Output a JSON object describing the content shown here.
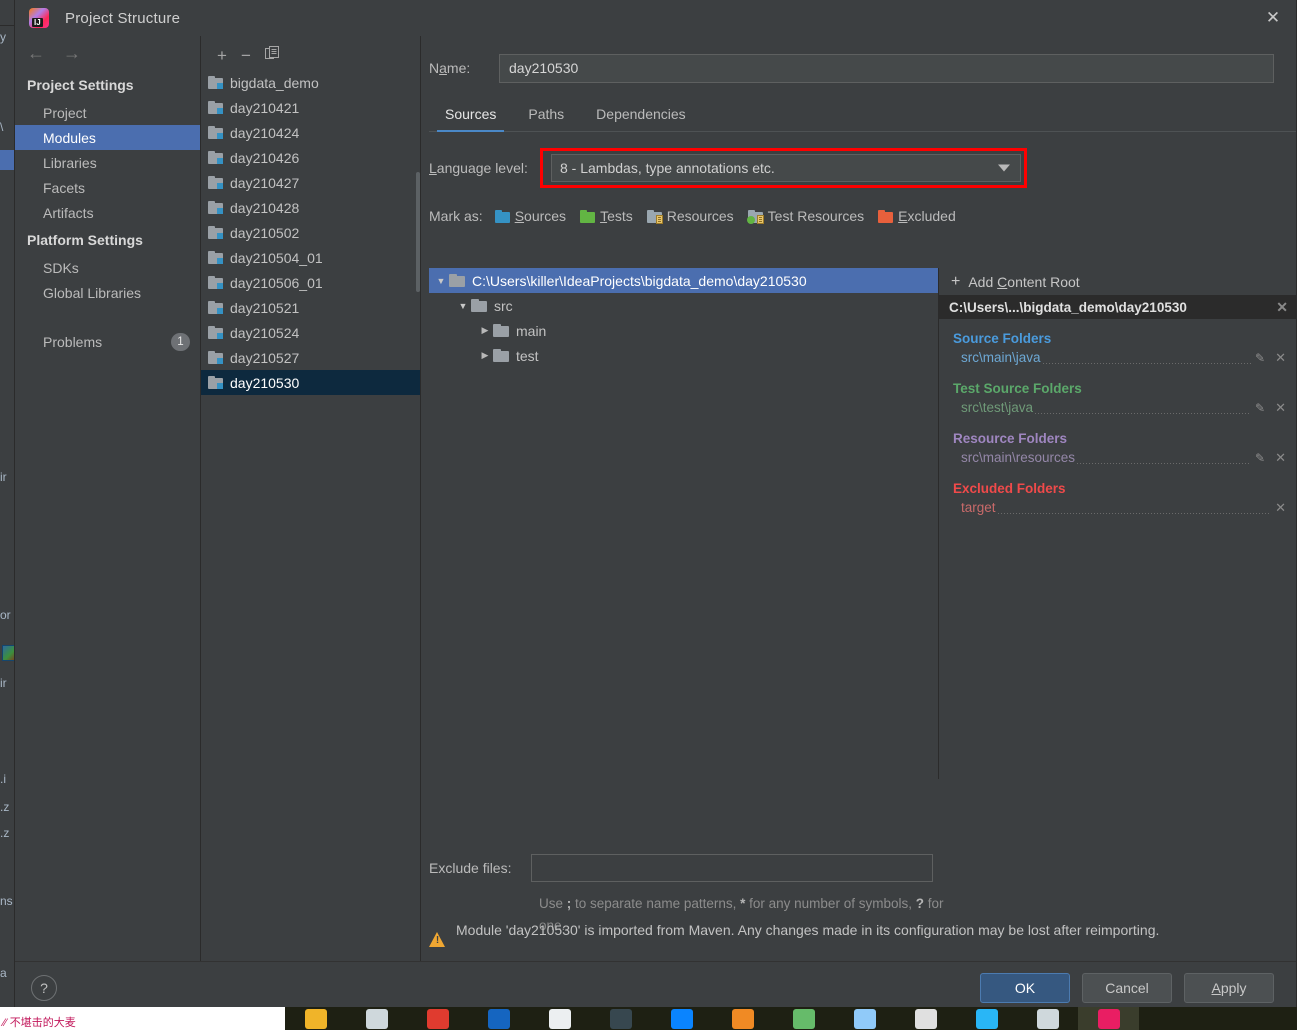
{
  "window": {
    "title": "Project Structure",
    "app_icon": "intellij-idea-icon",
    "close_icon": "✕"
  },
  "nav": {
    "back_icon": "←",
    "forward_icon": "→",
    "groups": [
      {
        "title": "Project Settings",
        "items": [
          {
            "label": "Project",
            "selected": false
          },
          {
            "label": "Modules",
            "selected": true
          },
          {
            "label": "Libraries",
            "selected": false
          },
          {
            "label": "Facets",
            "selected": false
          },
          {
            "label": "Artifacts",
            "selected": false
          }
        ]
      },
      {
        "title": "Platform Settings",
        "items": [
          {
            "label": "SDKs",
            "selected": false
          },
          {
            "label": "Global Libraries",
            "selected": false
          }
        ]
      }
    ],
    "problems": {
      "label": "Problems",
      "count": "1"
    }
  },
  "modules": {
    "toolbar": {
      "add_icon": "+",
      "remove_icon": "−",
      "copy_icon": "copy-icon"
    },
    "items": [
      {
        "label": "bigdata_demo",
        "selected": false
      },
      {
        "label": "day210421",
        "selected": false
      },
      {
        "label": "day210424",
        "selected": false
      },
      {
        "label": "day210426",
        "selected": false
      },
      {
        "label": "day210427",
        "selected": false
      },
      {
        "label": "day210428",
        "selected": false
      },
      {
        "label": "day210502",
        "selected": false
      },
      {
        "label": "day210504_01",
        "selected": false
      },
      {
        "label": "day210506_01",
        "selected": false
      },
      {
        "label": "day210521",
        "selected": false
      },
      {
        "label": "day210524",
        "selected": false
      },
      {
        "label": "day210527",
        "selected": false
      },
      {
        "label": "day210530",
        "selected": true
      }
    ]
  },
  "main": {
    "name_label": "Name:",
    "name_value": "day210530",
    "tabs": [
      {
        "label": "Sources",
        "active": true
      },
      {
        "label": "Paths",
        "active": false
      },
      {
        "label": "Dependencies",
        "active": false
      }
    ],
    "language_level": {
      "label": "Language level:",
      "value": "8 - Lambdas, type annotations etc.",
      "highlight_color": "#ff0000"
    },
    "mark_as": {
      "label": "Mark as:",
      "options": [
        {
          "label": "Sources",
          "color": "#3592c4"
        },
        {
          "label": "Tests",
          "color": "#62b543"
        },
        {
          "label": "Resources",
          "color": "#9aa7b0"
        },
        {
          "label": "Test Resources",
          "color": "#9aa7b0"
        },
        {
          "label": "Excluded",
          "color": "#e8603c"
        }
      ]
    },
    "tree": [
      {
        "label": "C:\\Users\\killer\\IdeaProjects\\bigdata_demo\\day210530",
        "depth": 0,
        "arrow": "down",
        "selected": true
      },
      {
        "label": "src",
        "depth": 1,
        "arrow": "down",
        "selected": false
      },
      {
        "label": "main",
        "depth": 2,
        "arrow": "right",
        "selected": false
      },
      {
        "label": "test",
        "depth": 2,
        "arrow": "right",
        "selected": false
      }
    ],
    "exclude": {
      "label": "Exclude files:",
      "value": "",
      "hint_a": "Use ",
      "hint_semicolon": ";",
      "hint_b": " to separate name patterns, ",
      "hint_star": "*",
      "hint_c": " for any number of symbols, ",
      "hint_q": "?",
      "hint_d": " for one."
    },
    "warning": "Module 'day210530' is imported from Maven. Any changes made in its configuration may be lost after reimporting."
  },
  "right_panel": {
    "add_content_root": "Add Content Root",
    "add_icon": "+",
    "root_path": "C:\\Users\\...\\bigdata_demo\\day210530",
    "root_remove_icon": "✕",
    "groups": [
      {
        "title": "Source Folders",
        "color": "#4a9bdd",
        "path_color": "#6da8d4",
        "rows": [
          {
            "path": "src\\main\\java",
            "edit_icon": "✎",
            "remove_icon": "✕"
          }
        ]
      },
      {
        "title": "Test Source Folders",
        "color": "#5ba86a",
        "path_color": "#6f9a78",
        "rows": [
          {
            "path": "src\\test\\java",
            "edit_icon": "✎",
            "remove_icon": "✕"
          }
        ]
      },
      {
        "title": "Resource Folders",
        "color": "#9f86c0",
        "path_color": "#9487a8",
        "rows": [
          {
            "path": "src\\main\\resources",
            "edit_icon": "✎",
            "remove_icon": "✕"
          }
        ]
      },
      {
        "title": "Excluded Folders",
        "color": "#f04a4a",
        "path_color": "#c96a6a",
        "rows": [
          {
            "path": "target",
            "edit_icon": "",
            "remove_icon": "✕"
          }
        ]
      }
    ]
  },
  "footer": {
    "help_icon": "?",
    "buttons": [
      {
        "label": "OK",
        "style": "default"
      },
      {
        "label": "Cancel",
        "style": "normal"
      },
      {
        "label": "Apply",
        "style": "normal"
      }
    ]
  },
  "taskbar": {
    "apps": [
      "file-explorer-icon",
      "notes-icon",
      "pdf-reader-icon",
      "cloud-drive-icon",
      "wechat-icon",
      "keyboard-icon",
      "edge-browser-icon",
      "folder-blue-icon",
      "green-app-icon",
      "window-app-icon",
      "paper-app-icon",
      "screen-app-icon",
      "pencil-app-icon",
      "intellij-idea-icon"
    ],
    "active_index": 13
  }
}
